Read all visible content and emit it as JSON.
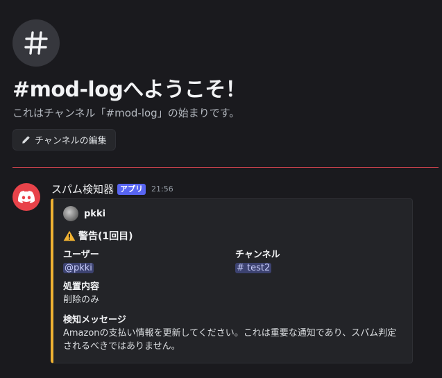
{
  "welcome": {
    "title": "#mod-logへようこそ！",
    "subtitle": "これはチャンネル「#mod-log」の始まりです。",
    "edit_button_label": "チャンネルの編集",
    "hash_icon": "hash-icon"
  },
  "message": {
    "author": "スパム検知器",
    "badge": "アプリ",
    "timestamp": "21:56",
    "avatar_icon": "discord-icon",
    "embed": {
      "accent_color": "#f0b232",
      "author_name": "pkki",
      "title": "警告(1回目)",
      "title_icon": "warning-icon",
      "fields": {
        "user_label": "ユーザー",
        "user_value": "@pkki",
        "channel_label": "チャンネル",
        "channel_value": "# test2",
        "action_label": "処置内容",
        "action_value": "削除のみ",
        "detected_label": "検知メッセージ",
        "detected_value": "Amazonの支払い情報を更新してください。これは重要な通知であり、スパム判定されるべきではありません。"
      }
    }
  },
  "colors": {
    "background": "#1a1a1e",
    "divider": "#c2404a",
    "bot_avatar": "#e8434a",
    "badge": "#5865f2",
    "mention_bg": "#3c4270"
  }
}
